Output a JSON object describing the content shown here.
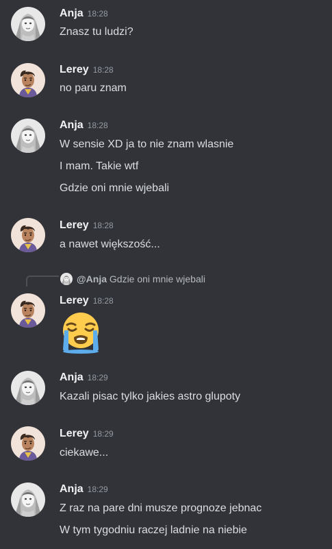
{
  "messages": [
    {
      "author": "Anja",
      "time": "18:28",
      "lines": [
        "Znasz tu ludzi?"
      ]
    },
    {
      "author": "Lerey",
      "time": "18:28",
      "lines": [
        "no paru znam"
      ]
    },
    {
      "author": "Anja",
      "time": "18:28",
      "lines": [
        "W sensie XD ja to nie znam wlasnie",
        "I mam. Takie wtf",
        "Gdzie oni mnie wjebali"
      ]
    },
    {
      "author": "Lerey",
      "time": "18:28",
      "lines": [
        "a nawet większość..."
      ]
    },
    {
      "author": "Lerey",
      "time": "18:28",
      "reply": {
        "author": "@Anja",
        "text": "Gdzie oni mnie wjebali"
      },
      "emoji": "loudly-crying-face"
    },
    {
      "author": "Anja",
      "time": "18:29",
      "lines": [
        "Kazali pisac tylko jakies astro glupoty"
      ]
    },
    {
      "author": "Lerey",
      "time": "18:29",
      "lines": [
        "ciekawe..."
      ]
    },
    {
      "author": "Anja",
      "time": "18:29",
      "lines": [
        "Z raz na pare dni musze prognoze jebnac",
        "W tym tygodniu raczej ladnie na niebie"
      ]
    }
  ],
  "colors": {
    "background": "#313338",
    "author": "#f2f3f5",
    "text": "#dbdee1",
    "timestamp": "#949ba4"
  }
}
